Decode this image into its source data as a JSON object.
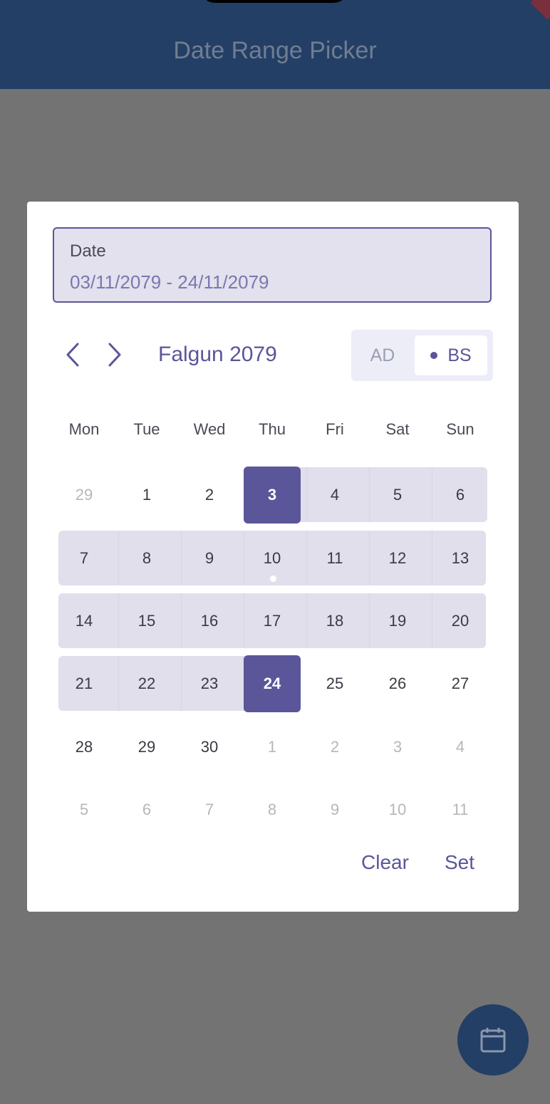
{
  "app": {
    "title": "Date Range Picker"
  },
  "picker": {
    "field_label": "Date",
    "field_value": "03/11/2079 - 24/11/2079",
    "month_title": "Falgun 2079",
    "toggle": {
      "ad": "AD",
      "bs": "BS",
      "selected": "BS"
    },
    "weekdays": [
      "Mon",
      "Tue",
      "Wed",
      "Thu",
      "Fri",
      "Sat",
      "Sun"
    ],
    "weeks": [
      [
        "29",
        "1",
        "2",
        "3",
        "4",
        "5",
        "6"
      ],
      [
        "7",
        "8",
        "9",
        "10",
        "11",
        "12",
        "13"
      ],
      [
        "14",
        "15",
        "16",
        "17",
        "18",
        "19",
        "20"
      ],
      [
        "21",
        "22",
        "23",
        "24",
        "25",
        "26",
        "27"
      ],
      [
        "28",
        "29",
        "30",
        "1",
        "2",
        "3",
        "4"
      ],
      [
        "5",
        "6",
        "7",
        "8",
        "9",
        "10",
        "11"
      ]
    ],
    "range_start": "3",
    "range_end": "24",
    "today": "10",
    "clear_label": "Clear",
    "set_label": "Set"
  },
  "colors": {
    "accent": "#5a5699",
    "appbar": "#233f66",
    "range_band": "#e0dfeb"
  },
  "icons": {
    "prev": "chevron-left-icon",
    "next": "chevron-right-icon",
    "fab": "calendar-icon"
  }
}
